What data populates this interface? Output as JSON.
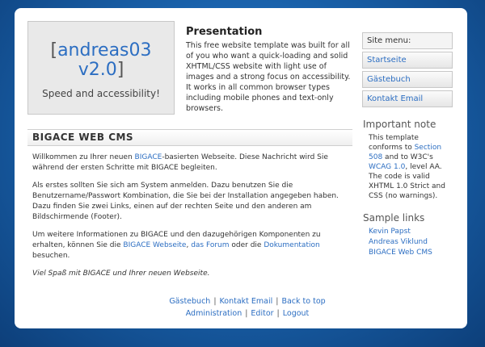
{
  "header": {
    "logo_bracket_open": "[",
    "logo_name": "andreas03",
    "logo_version": "v2.0",
    "logo_bracket_close": "]",
    "logo_slogan": "Speed and accessibility!",
    "intro_title": "Presentation",
    "intro_text": "This free website template was built for all of you who want a quick-loading and solid XHTML/CSS website with light use of images and a strong focus on accessibility. It works in all common browser types including mobile phones and text-only browsers."
  },
  "main": {
    "section_title": "BIGACE WEB CMS",
    "p1_a": "Willkommen zu Ihrer neuen ",
    "p1_link": "BIGACE",
    "p1_b": "-basierten Webseite. Diese Nachricht wird Sie während der ersten Schritte mit BIGACE begleiten.",
    "p2": "Als erstes sollten Sie sich am System anmelden. Dazu benutzen Sie die Benutzername/Passwort Kombination, die Sie bei der Installation angegeben haben. Dazu finden Sie zwei Links, einen auf der rechten Seite und den anderen am Bildschirmende (Footer).",
    "p3_a": "Um weitere Informationen zu BIGACE und den dazugehörigen Komponenten zu erhalten, können Sie die ",
    "p3_link1": "BIGACE Webseite",
    "p3_sep": ", ",
    "p3_link2": "das Forum",
    "p3_b": " oder die ",
    "p3_link3": "Dokumentation",
    "p3_c": " besuchen.",
    "p4": "Viel Spaß mit BIGACE und Ihrer neuen Webseite."
  },
  "sidebar": {
    "menu_title": "Site menu:",
    "menu_items": [
      "Startseite",
      "Gästebuch",
      "Kontakt Email"
    ],
    "note_title": "Important note",
    "note_a": "This template conforms to ",
    "note_link1": "Section 508",
    "note_b": " and to W3C's ",
    "note_link2": "WCAG 1.0",
    "note_c": ", level AA. The code is valid XHTML 1.0 Strict and CSS (no warnings).",
    "links_title": "Sample links",
    "links": [
      "Kevin Papst",
      "Andreas Viklund",
      "BIGACE Web CMS"
    ]
  },
  "footer": {
    "row1": [
      "Gästebuch",
      "Kontakt Email",
      "Back to top"
    ],
    "row2": [
      "Administration",
      "Editor",
      "Logout"
    ],
    "separator": "|"
  }
}
